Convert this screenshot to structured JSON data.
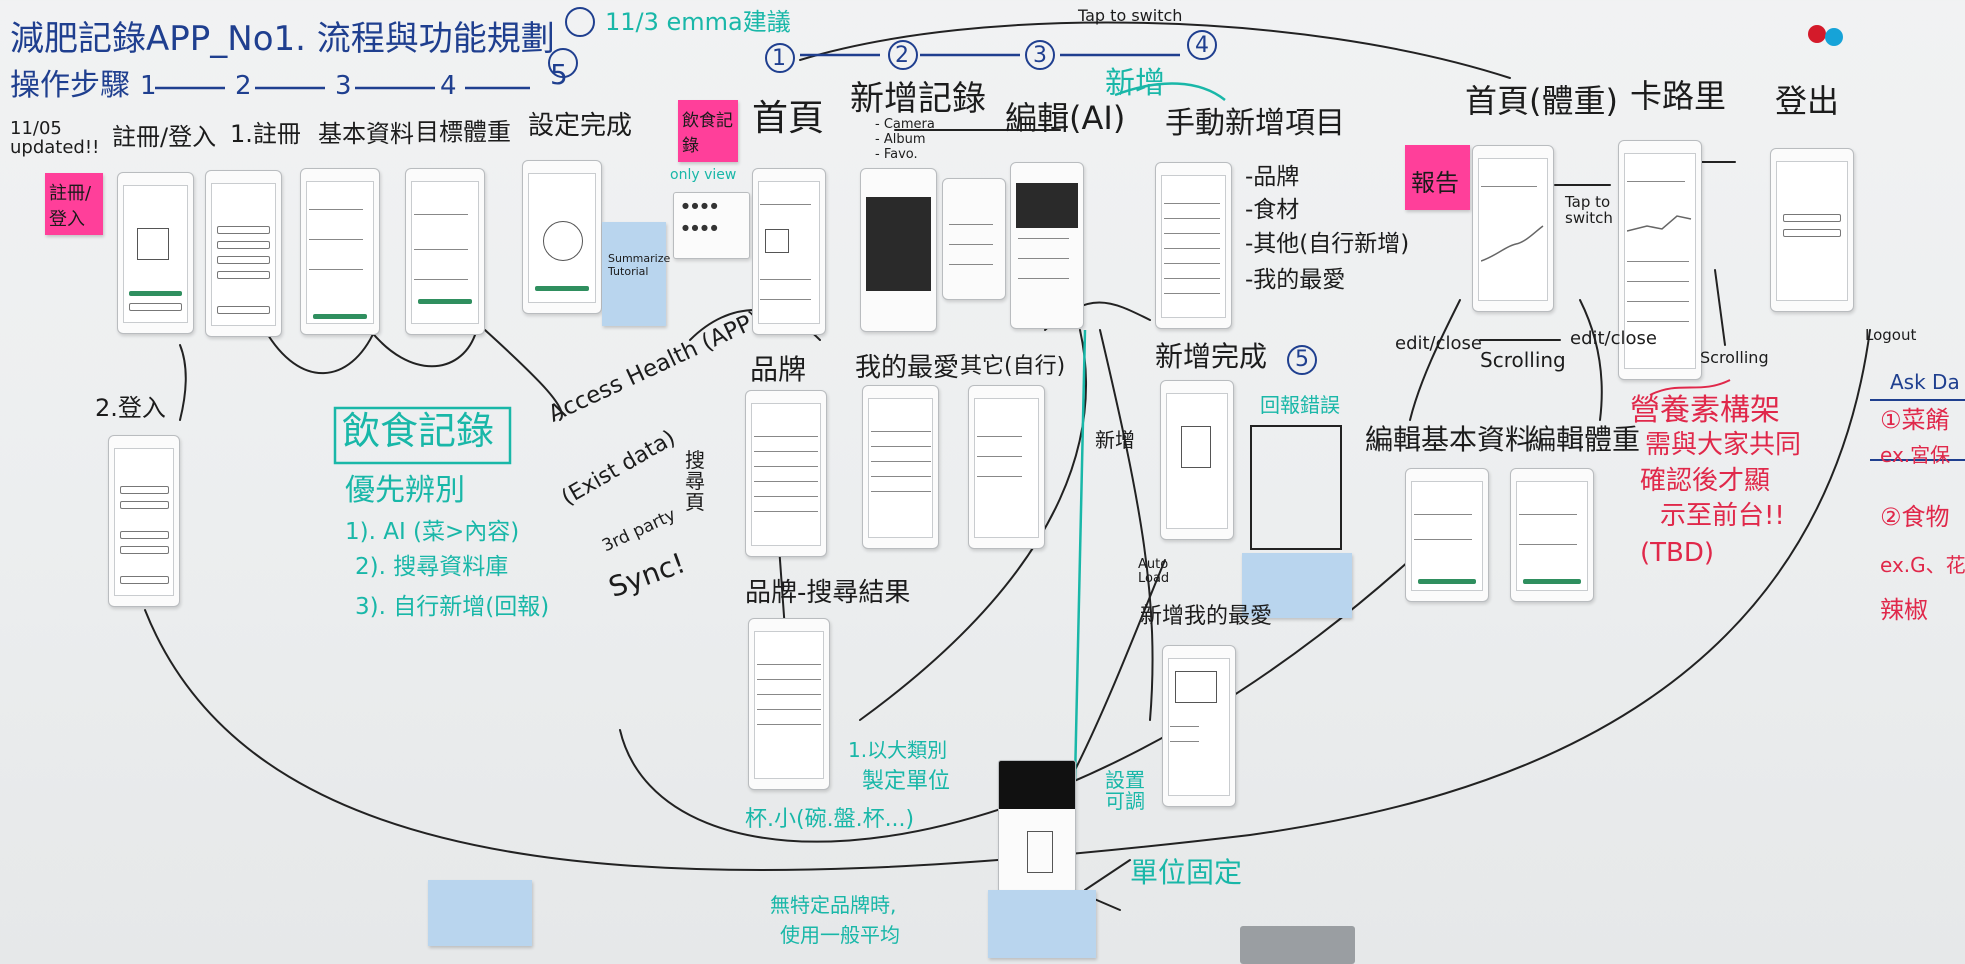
{
  "board": {
    "title": "減肥記錄APP_No1. 流程與功能規劃",
    "steps_label": "操作步驟",
    "steps": [
      "1",
      "2",
      "3",
      "4",
      "5"
    ],
    "updated_note": "11/05 updated!!",
    "emma_note": "11/3 emma建議",
    "onboarding_headers": [
      "註冊/登入",
      "1.註冊",
      "基本資料",
      "目標體重",
      "設定完成"
    ],
    "login_label": "2.登入",
    "summarize_card": "Summarize Tutorial",
    "diet_record_title": "飲食記錄",
    "priority_heading": "優先辨別",
    "priority_items": [
      "1). AI (菜>內容)",
      "2). 搜尋資料庫",
      "3). 自行新增(回報)"
    ],
    "access_health": "Access Health (APP)",
    "exist_data": "(Exist data)",
    "third_party": "3rd party",
    "sync": "Sync!",
    "tap_to_switch_top": "Tap to switch",
    "top_steps": [
      "1",
      "2",
      "3",
      "4"
    ],
    "main_headers": [
      "首頁",
      "新增記錄",
      "編輯(AI)",
      "手動新增項目"
    ],
    "add_record_sub": [
      "- Camera",
      "- Album",
      "- Favo."
    ],
    "only_view": "only view",
    "new_add": "新增",
    "brand": "品牌",
    "my_favorite": "我的最愛",
    "other_self": "其它(自行)",
    "brand_search_result": "品牌-搜尋結果",
    "search_label": "搜尋頁",
    "manual_items": [
      "-品牌",
      "-食材",
      "-其他(自行新增)",
      "-我的最愛"
    ],
    "add_done": "新增完成",
    "add_done_num": "5",
    "report_error": "回報錯誤",
    "new_label": "新增",
    "auto_load": "Auto Load",
    "new_my_favorite": "新增我的最愛",
    "category_units": [
      "1.以大類別",
      "製定單位"
    ],
    "portion_units": "杯.小(碗.盤.杯...)",
    "adjust_qty": "設置可調",
    "unit_fixed": "單位固定",
    "no_brand_note": [
      "無特定品牌時,",
      "使用一般平均"
    ],
    "home_weight": "首頁(體重)",
    "calorie": "卡路里",
    "logout_header": "登出",
    "report_sticky": "報告",
    "diet_sticky": "飲食記錄",
    "signup_sticky": "註冊/登入",
    "tap_to_switch_right": "Tap to switch",
    "edit_close_left": "edit/close",
    "scrolling": "Scrolling",
    "edit_close_right": "edit/close",
    "scrolling_right": "Scrolling",
    "logout": "Logout",
    "edit_profile": "編輯基本資料",
    "edit_weight": "編輯體重",
    "nutrition_note": [
      "營養素構架",
      "需與大家共同",
      "確認後才顯",
      "示至前台!!",
      "(TBD)"
    ],
    "right_edge_header": "Ask Da",
    "right_edge_items": [
      "①菜餚",
      "ex.宮保",
      "②食物",
      "ex.G、花生",
      "辣椒"
    ],
    "colors": {
      "navy": "#1f3f8f",
      "teal": "#19b7a8",
      "pink_note": "#ff3f9a",
      "blue_note": "#b9d5ee",
      "red": "#e0284a",
      "ink": "#1c1c1c"
    }
  }
}
